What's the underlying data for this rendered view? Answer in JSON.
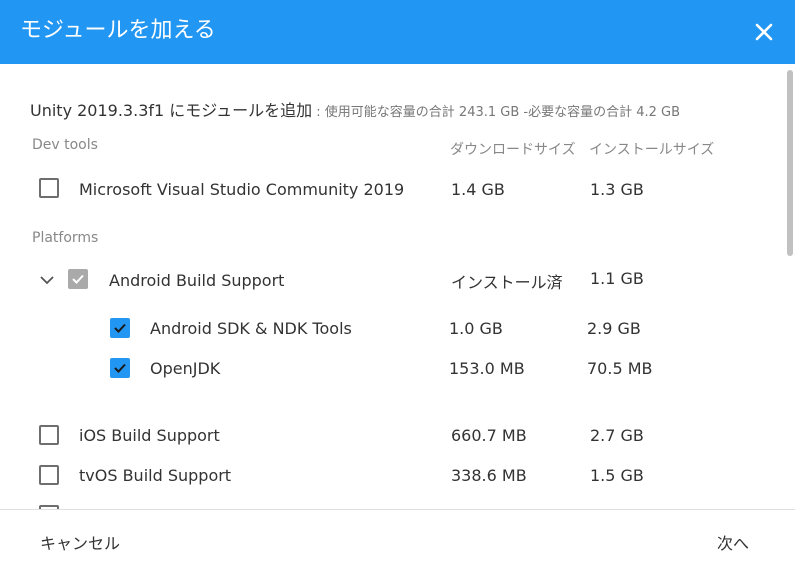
{
  "header": {
    "title": "モジュールを加える"
  },
  "summary": {
    "main": "Unity 2019.3.3f1 にモジュールを追加",
    "detail": " : 使用可能な容量の合計 243.1 GB -必要な容量の合計 4.2 GB"
  },
  "columns": {
    "download": "ダウンロードサイズ",
    "install": "インストールサイズ"
  },
  "sections": {
    "dev_tools": "Dev tools",
    "platforms": "Platforms"
  },
  "modules": {
    "vs": {
      "label": "Microsoft Visual Studio Community 2019",
      "download": "1.4 GB",
      "install": "1.3 GB"
    },
    "android": {
      "label": "Android Build Support",
      "download": "インストール済",
      "install": "1.1 GB"
    },
    "sdk": {
      "label": "Android SDK & NDK Tools",
      "download": "1.0 GB",
      "install": "2.9 GB"
    },
    "jdk": {
      "label": "OpenJDK",
      "download": "153.0 MB",
      "install": "70.5 MB"
    },
    "ios": {
      "label": "iOS Build Support",
      "download": "660.7 MB",
      "install": "2.7 GB"
    },
    "tvos": {
      "label": "tvOS Build Support",
      "download": "338.6 MB",
      "install": "1.5 GB"
    }
  },
  "footer": {
    "cancel": "キャンセル",
    "next": "次へ"
  },
  "icons": {
    "close": "close-icon",
    "check": "check-icon",
    "expand": "chevron-down-icon"
  },
  "colors": {
    "accent": "#2196f3",
    "disabled_check": "#aaaaaa"
  }
}
